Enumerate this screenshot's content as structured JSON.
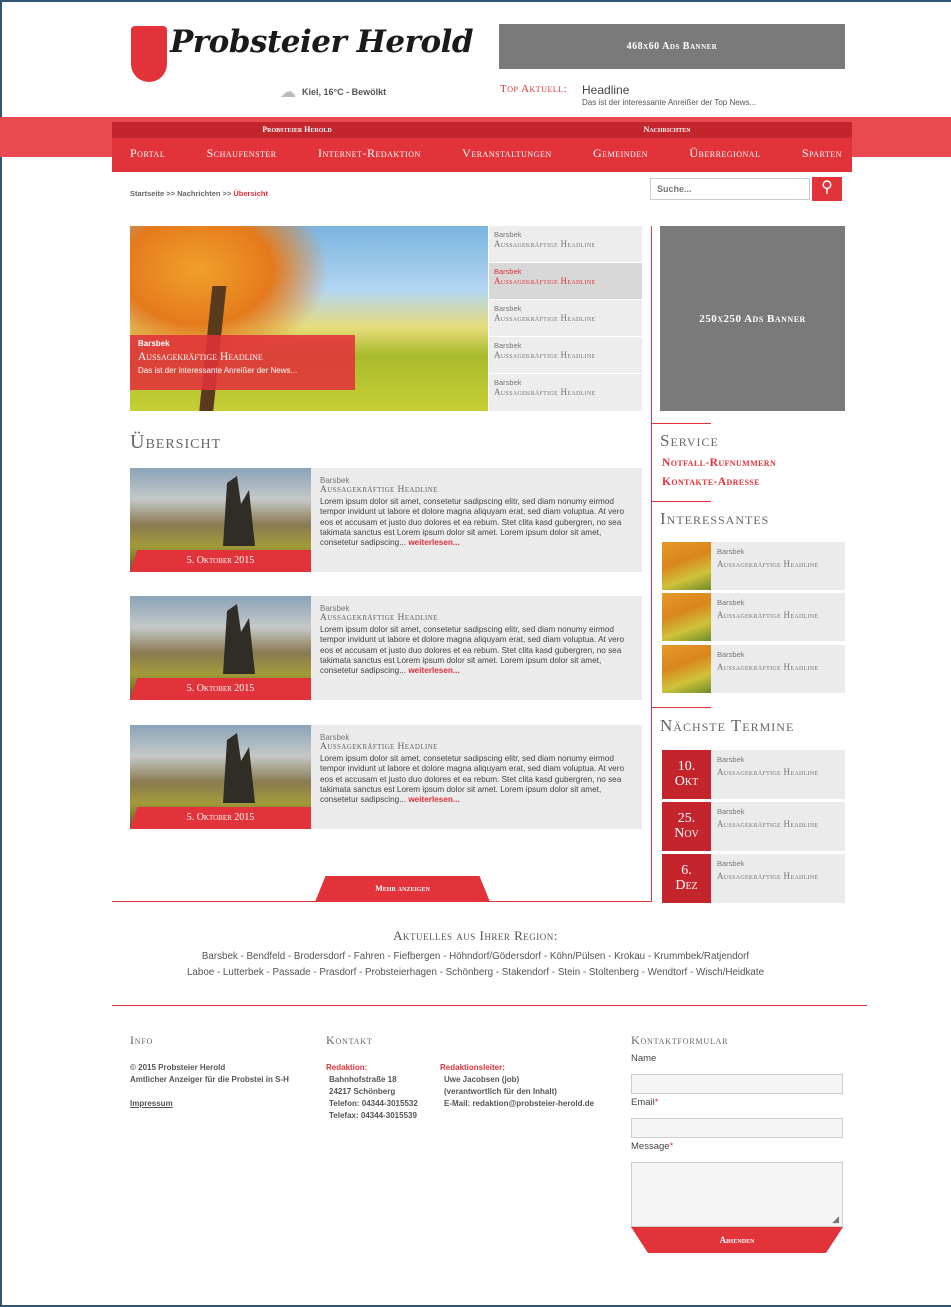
{
  "header": {
    "logo_text": "Probsteier Herold",
    "weather": "Kiel, 16°C - Bewölkt",
    "banner_top": "468x60 Ads Banner",
    "top_news_label": "Top Aktuell:",
    "top_news_headline": "Headline",
    "top_news_teaser": "Das ist der interessante Anreißer der Top News..."
  },
  "nav": {
    "top": [
      "Probsteier Herold",
      "Nachrichten"
    ],
    "items": [
      "Portal",
      "Schaufenster",
      "Internet-Redaktion",
      "Veranstaltungen",
      "Gemeinden",
      "Überregional",
      "Sparten"
    ]
  },
  "breadcrumb": {
    "path": "Startseite >> Nachrichten >> ",
    "current": "Übersicht"
  },
  "search": {
    "placeholder": "Suche..."
  },
  "slider": {
    "caption": {
      "kicker": "Barsbek",
      "headline": "Aussagekräftige Headline",
      "teaser": "Das ist der interessante Anreißer der News..."
    },
    "list": [
      {
        "kicker": "Barsbek",
        "headline": "Aussagekräftige Headline"
      },
      {
        "kicker": "Barsbek",
        "headline": "Aussagekräftige Headline"
      },
      {
        "kicker": "Barsbek",
        "headline": "Aussagekräftige Headline"
      },
      {
        "kicker": "Barsbek",
        "headline": "Aussagekräftige Headline"
      },
      {
        "kicker": "Barsbek",
        "headline": "Aussagekräftige Headline"
      }
    ]
  },
  "overview": {
    "title": "Übersicht",
    "articles": [
      {
        "date": "5. Oktober 2015",
        "kicker": "Barsbek",
        "headline": "Aussagekräftige Headline",
        "body": "Lorem ipsum dolor sit amet, consetetur sadipscing elitr, sed diam nonumy eirmod tempor invidunt ut labore et dolore magna aliquyam erat, sed diam voluptua. At vero eos et accusam et justo duo dolores et ea rebum. Stet clita kasd gubergren, no sea takimata sanctus est Lorem ipsum dolor sit amet. Lorem ipsum dolor sit amet, consetetur sadipscing...",
        "more": "weiterlesen..."
      },
      {
        "date": "5. Oktober 2015",
        "kicker": "Barsbek",
        "headline": "Aussagekräftige Headline",
        "body": "Lorem ipsum dolor sit amet, consetetur sadipscing elitr, sed diam nonumy eirmod tempor invidunt ut labore et dolore magna aliquyam erat, sed diam voluptua. At vero eos et accusam et justo duo dolores et ea rebum. Stet clita kasd gubergren, no sea takimata sanctus est Lorem ipsum dolor sit amet. Lorem ipsum dolor sit amet, consetetur sadipscing...",
        "more": "weiterlesen..."
      },
      {
        "date": "5. Oktober 2015",
        "kicker": "Barsbek",
        "headline": "Aussagekräftige Headline",
        "body": "Lorem ipsum dolor sit amet, consetetur sadipscing elitr, sed diam nonumy eirmod tempor invidunt ut labore et dolore magna aliquyam erat, sed diam voluptua. At vero eos et accusam et justo duo dolores et ea rebum. Stet clita kasd gubergren, no sea takimata sanctus est Lorem ipsum dolor sit amet. Lorem ipsum dolor sit amet, consetetur sadipscing...",
        "more": "weiterlesen..."
      }
    ],
    "more_button": "Mehr anzeigen"
  },
  "sidebar": {
    "banner": "250x250 Ads Banner",
    "service_title": "Service",
    "service_links": [
      "Notfall-Rufnummern",
      "Kontakte-Adresse"
    ],
    "interesting_title": "Interessantes",
    "interesting": [
      {
        "kicker": "Barsbek",
        "headline": "Aussagekräftige Headline"
      },
      {
        "kicker": "Barsbek",
        "headline": "Aussagekräftige Headline"
      },
      {
        "kicker": "Barsbek",
        "headline": "Aussagekräftige Headline"
      }
    ],
    "events_title": "Nächste Termine",
    "events": [
      {
        "day": "10.",
        "month": "Okt",
        "kicker": "Barsbek",
        "headline": "Aussagekräftige Headline"
      },
      {
        "day": "25.",
        "month": "Nov",
        "kicker": "Barsbek",
        "headline": "Aussagekräftige Headline"
      },
      {
        "day": "6.",
        "month": "Dez",
        "kicker": "Barsbek",
        "headline": "Aussagekräftige Headline"
      }
    ]
  },
  "region": {
    "title": "Aktuelles aus Ihrer Region:",
    "line1": "Barsbek - Bendfeld - Brodersdorf - Fahren - Fiefbergen - Höhndorf/Gödersdorf - Köhn/Pülsen - Krokau - Krummbek/Ratjendorf",
    "line2": "Laboe - Lutterbek - Passade - Prasdorf - Probsteierhagen - Schönberg - Stakendorf - Stein - Stoltenberg - Wendtorf - Wisch/Heidkate"
  },
  "footer": {
    "info_title": "Info",
    "info_lines": [
      "© 2015 Probsteier Herold",
      "Amtlicher Anzeiger für die Probstei in S-H"
    ],
    "impressum": "Impressum",
    "contact_title": "Kontakt",
    "redaktion_label": "Redaktion:",
    "redaktion_lines": [
      "Bahnhofstraße 18",
      "24217 Schönberg",
      "Telefon: 04344-3015532",
      "Telefax: 04344-3015539"
    ],
    "leiter_label": "Redaktionsleiter:",
    "leiter_lines": [
      "Uwe Jacobsen (job)",
      "(verantwortlich für den Inhalt)",
      "E-Mail: redaktion@probsteier-herold.de"
    ],
    "form_title": "Kontaktformular",
    "name_label": "Name",
    "email_label": "Email",
    "message_label": "Message",
    "required_mark": "*",
    "submit": "Absenden"
  },
  "colors": {
    "accent": "#e2323a",
    "grey_banner": "#7a7a7a",
    "light_bg": "#ebebeb"
  }
}
